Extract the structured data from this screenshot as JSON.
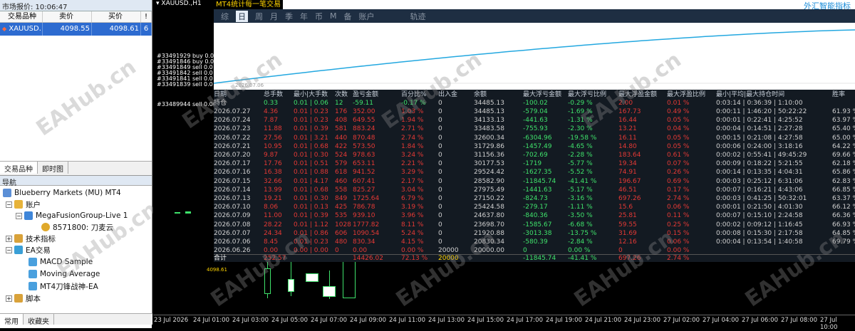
{
  "market_watch": {
    "title": "市场报价: 10:06:47",
    "columns": [
      "交易品种",
      "卖价",
      "买价",
      "!"
    ],
    "row": {
      "symbol": "XAUUSD.",
      "bid": "4098.55",
      "ask": "4098.61",
      "spread": "6"
    },
    "tabs": [
      "交易品种",
      "即时图"
    ]
  },
  "navigator": {
    "title": "导航",
    "items": [
      {
        "label": "Blueberry Markets (MU) MT4"
      },
      {
        "label": "账户"
      },
      {
        "label": "MegaFusionGroup-Live 1"
      },
      {
        "label": "8571800: 刀麦云"
      },
      {
        "label": "技术指标"
      },
      {
        "label": "EA交易"
      },
      {
        "label": "MACD Sample"
      },
      {
        "label": "Moving Average"
      },
      {
        "label": "MT4刀锋战神-EA"
      },
      {
        "label": "脚本"
      }
    ],
    "bottom_tabs": [
      "常用",
      "收藏夹"
    ]
  },
  "chart": {
    "title": "XAUUSD.,H1",
    "orders": [
      "#33491929 buy 0.0",
      "#33491846 buy 0.0",
      "#33491849 sell 0.0",
      "#33491842 sell 0.0",
      "#33491841 sell 0.0",
      "#33491839 sell 0.0",
      "#33489944 sell 0.00"
    ],
    "time_axis": [
      "23 Jul 2026",
      "24 Jul 01:00",
      "24 Jul 03:00",
      "24 Jul 05:00",
      "24 Jul 07:00",
      "24 Jul 09:00",
      "24 Jul 11:00",
      "24 Jul 13:00",
      "24 Jul 15:00",
      "24 Jul 17:00",
      "24 Jul 19:00",
      "24 Jul 21:00",
      "24 Jul 23:00",
      "27 Jul 02:00",
      "27 Jul 04:00",
      "27 Jul 06:00",
      "27 Jul 08:00",
      "27 Jul 10:00"
    ],
    "price_label": "4098.61"
  },
  "widget": {
    "title": "MT4统计每一笔交易",
    "brand": "外汇智能指标",
    "nav": [
      "综",
      "日",
      "周",
      "月",
      "季",
      "年",
      "币",
      "M",
      "备",
      "账户",
      "轨迹"
    ],
    "plot_date": "2026.07.06",
    "headers": [
      "日期",
      "总手数",
      "最小|大手数",
      "次数",
      "盈亏金额",
      "百分比%",
      "出入金",
      "余额",
      "最大浮亏金额",
      "最大浮亏比例",
      "最大浮盈金额",
      "最大浮盈比例",
      "最小|平均|最大持仓时间",
      "胜率"
    ],
    "holding": [
      "持仓",
      "0.33",
      "0.01 | 0.06",
      "12",
      "-59.11",
      "-0.17 %",
      "0",
      "34485.13",
      "-100.02",
      "-0.29 %",
      "2.00",
      "0.01 %",
      "0:03:14 | 0:36:39 | 1:10:00",
      ""
    ],
    "rows": [
      [
        "2026.07.27",
        "4.36",
        "0.01 | 0.23",
        "176",
        "352.00",
        "1.03 %",
        "0",
        "34485.13",
        "-579.04",
        "-1.69 %",
        "167.73",
        "0.49 %",
        "0:00:11 | 1:46:20 | 50:22:22",
        "61.93 %"
      ],
      [
        "2026.07.24",
        "7.87",
        "0.01 | 0.23",
        "408",
        "649.55",
        "1.94 %",
        "0",
        "34133.13",
        "-441.63",
        "-1.31 %",
        "16.44",
        "0.05 %",
        "0:00:01 | 0:22:41 | 4:25:52",
        "63.97 %"
      ],
      [
        "2026.07.23",
        "11.88",
        "0.01 | 0.39",
        "581",
        "883.24",
        "2.71 %",
        "0",
        "33483.58",
        "-755.93",
        "-2.30 %",
        "13.21",
        "0.04 %",
        "0:00:04 | 0:14:51 | 2:27:28",
        "65.40 %"
      ],
      [
        "2026.07.22",
        "27.56",
        "0.01 | 3.21",
        "440",
        "870.48",
        "2.74 %",
        "0",
        "32600.34",
        "-6304.96",
        "-19.58 %",
        "16.11",
        "0.05 %",
        "0:00:15 | 0:21:08 | 4:27:58",
        "65.00 %"
      ],
      [
        "2026.07.21",
        "10.95",
        "0.01 | 0.68",
        "422",
        "573.50",
        "1.84 %",
        "0",
        "31729.86",
        "-1457.49",
        "-4.65 %",
        "14.80",
        "0.05 %",
        "0:00:06 | 0:24:00 | 3:18:16",
        "64.22 %"
      ],
      [
        "2026.07.20",
        "9.87",
        "0.01 | 0.30",
        "524",
        "978.63",
        "3.24 %",
        "0",
        "31156.36",
        "-702.69",
        "-2.28 %",
        "183.64",
        "0.61 %",
        "0:00:02 | 0:55:41 | 49:45:29",
        "69.66 %"
      ],
      [
        "2026.07.17",
        "17.76",
        "0.01 | 0.51",
        "579",
        "653.11",
        "2.21 %",
        "0",
        "30177.53",
        "-1719",
        "-5.77 %",
        "19.34",
        "0.07 %",
        "0:00:09 | 0:18:22 | 5:21:55",
        "62.18 %"
      ],
      [
        "2026.07.16",
        "16.38",
        "0.01 | 0.88",
        "618",
        "941.52",
        "3.29 %",
        "0",
        "29524.42",
        "-1627.35",
        "-5.52 %",
        "74.91",
        "0.26 %",
        "0:00:14 | 0:13:35 | 4:04:31",
        "65.86 %"
      ],
      [
        "2026.07.15",
        "32.66",
        "0.01 | 4.17",
        "460",
        "607.41",
        "2.17 %",
        "0",
        "28582.90",
        "-11845.74",
        "-41.41 %",
        "196.67",
        "0.69 %",
        "0:00:03 | 0:25:12 | 6:31:06",
        "62.83 %"
      ],
      [
        "2026.07.14",
        "13.99",
        "0.01 | 0.68",
        "558",
        "825.27",
        "3.04 %",
        "0",
        "27975.49",
        "-1441.63",
        "-5.17 %",
        "46.51",
        "0.17 %",
        "0:00:07 | 0:16:21 | 4:43:06",
        "66.85 %"
      ],
      [
        "2026.07.13",
        "19.21",
        "0.01 | 0.30",
        "849",
        "1725.64",
        "6.79 %",
        "0",
        "27150.22",
        "-824.73",
        "-3.16 %",
        "697.26",
        "2.74 %",
        "0:00:03 | 0:41:25 | 50:32:01",
        "63.37 %"
      ],
      [
        "2026.07.10",
        "8.06",
        "0.01 | 0.13",
        "425",
        "786.78",
        "3.19 %",
        "0",
        "25424.58",
        "-279.17",
        "-1.11 %",
        "15.6",
        "0.06 %",
        "0:00:01 | 0:21:50 | 4:01:30",
        "66.12 %"
      ],
      [
        "2026.07.09",
        "11.00",
        "0.01 | 0.39",
        "535",
        "939.10",
        "3.96 %",
        "0",
        "24637.80",
        "-840.36",
        "-3.50 %",
        "25.81",
        "0.11 %",
        "0:00:07 | 0:15:10 | 2:24:58",
        "66.36 %"
      ],
      [
        "2026.07.08",
        "28.22",
        "0.01 | 1.12",
        "1028",
        "1777.82",
        "8.11 %",
        "0",
        "23698.70",
        "-1585.67",
        "-6.68 %",
        "59.55",
        "0.25 %",
        "0:00:02 | 0:09:12 | 1:16:45",
        "66.93 %"
      ],
      [
        "2026.07.07",
        "24.34",
        "0.01 | 0.86",
        "606",
        "1090.54",
        "5.24 %",
        "0",
        "21920.88",
        "-3013.38",
        "-13.75 %",
        "31.69",
        "0.15 %",
        "0:00:08 | 0:15:30 | 2:17:58",
        "64.85 %"
      ],
      [
        "2026.07.06",
        "8.45",
        "0.01 | 0.23",
        "480",
        "830.34",
        "4.15 %",
        "0",
        "20830.34",
        "-580.39",
        "-2.84 %",
        "12.16",
        "0.06 %",
        "0:00:04 | 0:13:54 | 1:40:58",
        "69.79 %"
      ],
      [
        "2026.06.26",
        "0.00",
        "0.00 | 0.00",
        "0",
        "0.00",
        "0.00 %",
        "20000",
        "20000.00",
        "0",
        "0.00 %",
        "0",
        "0.00 %",
        "",
        ""
      ]
    ],
    "total": [
      "合计",
      "252.57",
      "",
      "",
      "14426.02",
      "72.13 %",
      "20000",
      "",
      "-11845.74",
      "-41.41 %",
      "697.26",
      "2.74 %",
      "",
      ""
    ]
  },
  "watermark": "EAHub.cn"
}
